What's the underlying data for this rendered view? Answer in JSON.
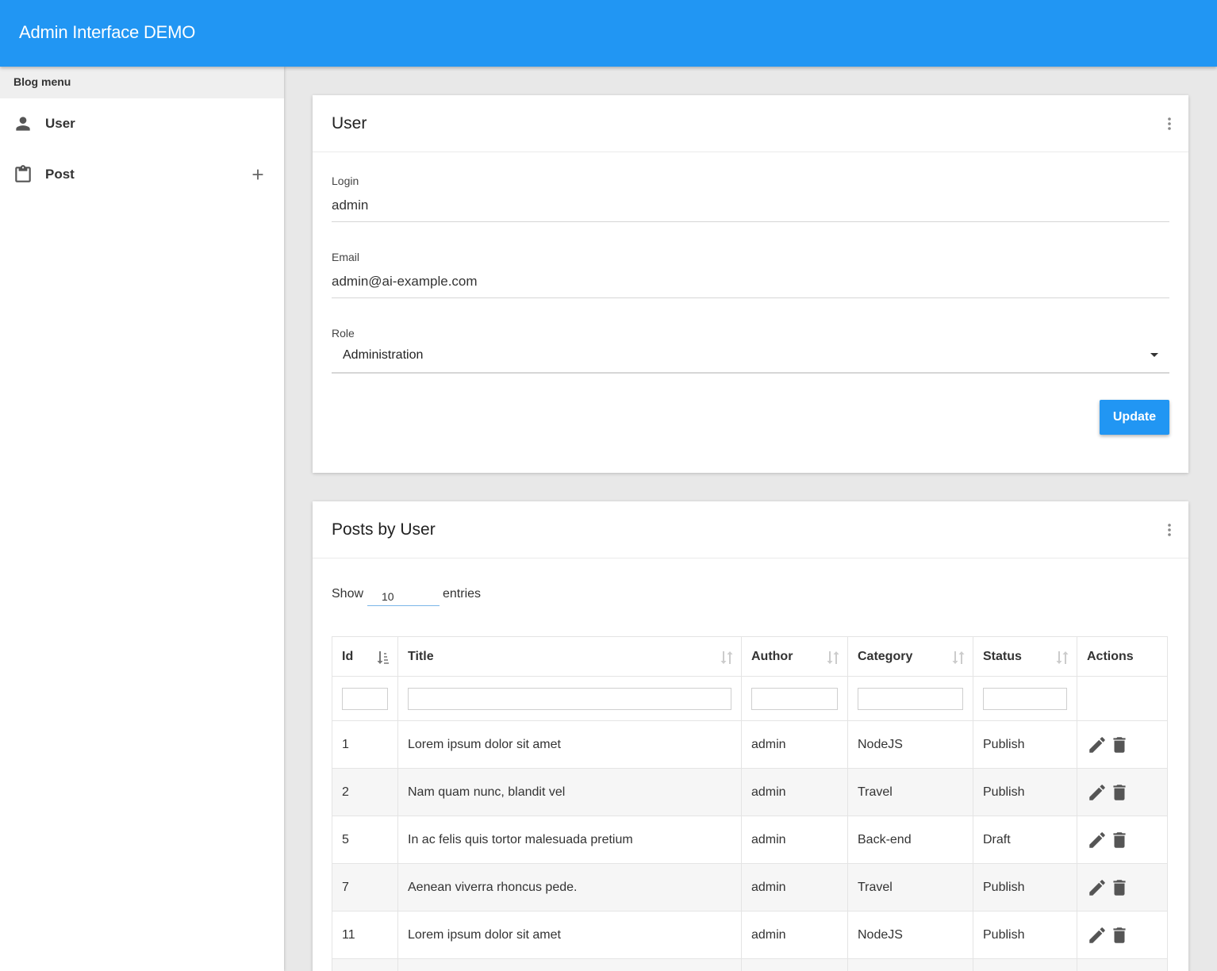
{
  "app": {
    "title": "Admin Interface DEMO"
  },
  "sidebar": {
    "header": "Blog menu",
    "items": [
      {
        "label": "User",
        "icon": "person-icon"
      },
      {
        "label": "Post",
        "icon": "clipboard-icon",
        "add_icon": "plus-icon"
      }
    ]
  },
  "user_card": {
    "title": "User",
    "login": {
      "label": "Login",
      "value": "admin"
    },
    "email": {
      "label": "Email",
      "value": "admin@ai-example.com"
    },
    "role": {
      "label": "Role",
      "value": "Administration"
    },
    "update_label": "Update"
  },
  "posts_card": {
    "title": "Posts by User",
    "show_label": "Show",
    "show_value": "10",
    "entries_label": "entries",
    "columns": [
      "Id",
      "Title",
      "Author",
      "Category",
      "Status",
      "Actions"
    ],
    "rows": [
      {
        "id": "1",
        "title": "Lorem ipsum dolor sit amet",
        "author": "admin",
        "category": "NodeJS",
        "status": "Publish"
      },
      {
        "id": "2",
        "title": "Nam quam nunc, blandit vel",
        "author": "admin",
        "category": "Travel",
        "status": "Publish"
      },
      {
        "id": "5",
        "title": "In ac felis quis tortor malesuada pretium",
        "author": "admin",
        "category": "Back-end",
        "status": "Draft"
      },
      {
        "id": "7",
        "title": "Aenean viverra rhoncus pede.",
        "author": "admin",
        "category": "Travel",
        "status": "Publish"
      },
      {
        "id": "11",
        "title": "Lorem ipsum dolor sit amet",
        "author": "admin",
        "category": "NodeJS",
        "status": "Publish"
      },
      {
        "id": "",
        "title": "",
        "author": "",
        "category": "",
        "status": ""
      }
    ]
  },
  "colors": {
    "primary": "#2196f3",
    "background": "#e8e8e8",
    "icon": "#555555"
  }
}
